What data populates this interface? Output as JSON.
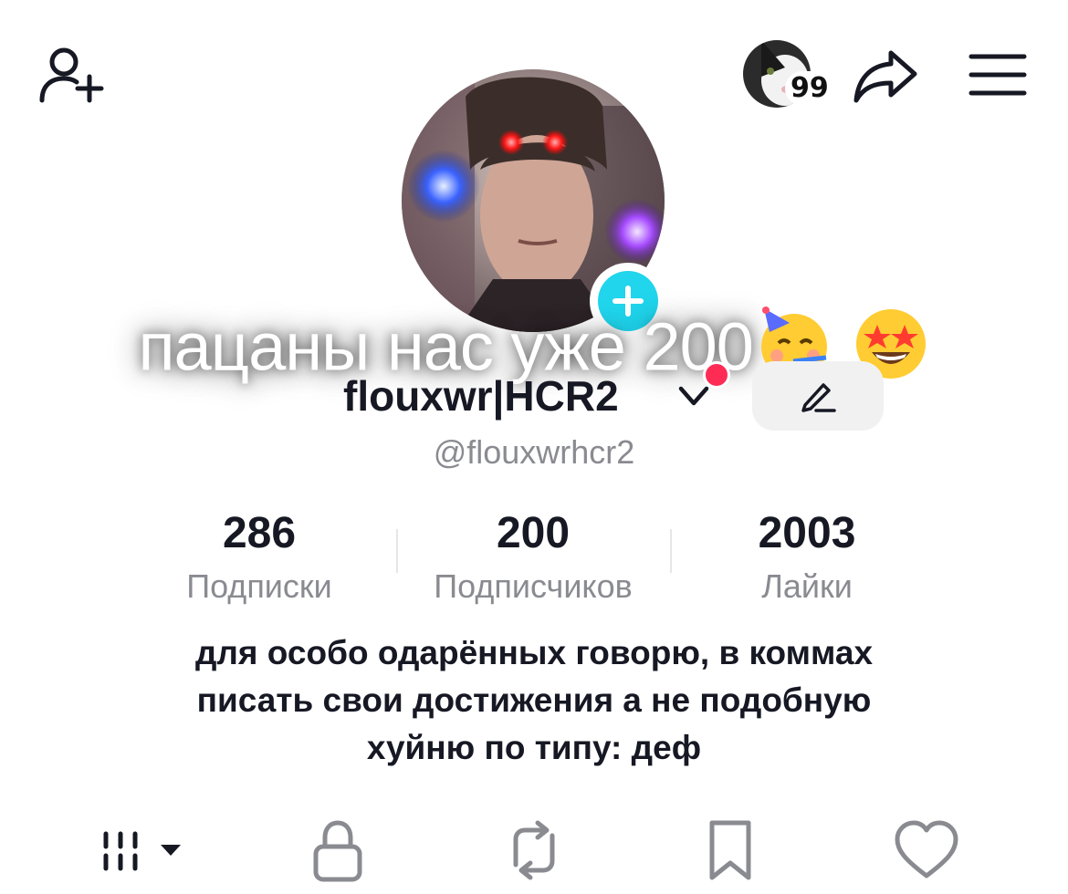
{
  "topbar": {
    "notification_count": "99"
  },
  "profile": {
    "caption_text": "пацаны нас уже 200",
    "caption_emojis": [
      "🥳",
      "🤩"
    ],
    "display_name": "flouxwr|HCR2",
    "username": "@flouxwrhcr2"
  },
  "stats": [
    {
      "value": "286",
      "label": "Подписки"
    },
    {
      "value": "200",
      "label": "Подписчиков"
    },
    {
      "value": "2003",
      "label": "Лайки"
    }
  ],
  "bio": {
    "lines": [
      "для особо одарённых говорю, в коммах",
      "писать свои достижения а не подобную",
      "хуйню по типу: деф"
    ]
  },
  "tabs": [
    "grid-icon",
    "lock-icon",
    "repost-icon",
    "bookmark-icon",
    "heart-icon"
  ],
  "colors": {
    "accent_cyan": "#20d5ec",
    "notification_red": "#fe2c55",
    "text_primary": "#161823",
    "text_secondary": "#8a8b91"
  }
}
